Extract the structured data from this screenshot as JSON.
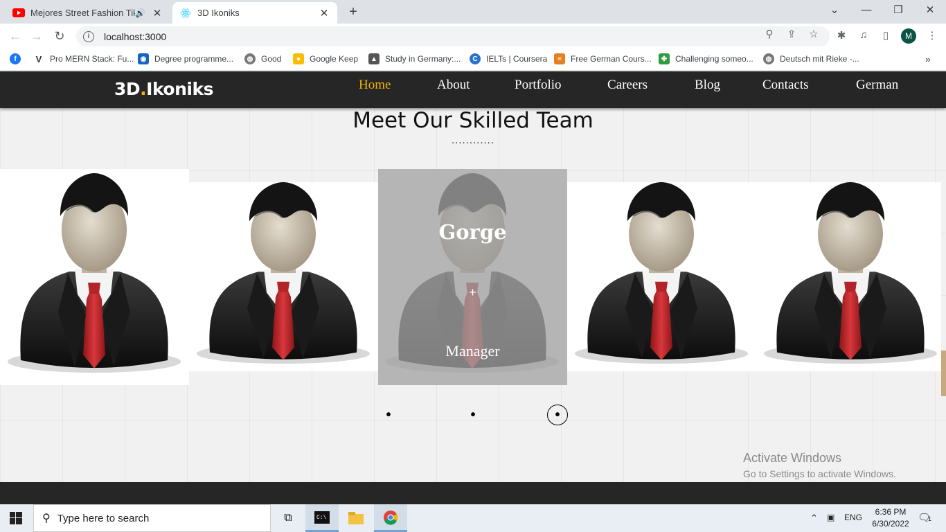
{
  "browser": {
    "tabs": [
      {
        "title": "Mejores Street Fashion Tik To",
        "active": false,
        "favicon": "youtube-icon",
        "audio": true
      },
      {
        "title": "3D Ikoniks",
        "active": true,
        "favicon": "react-icon"
      }
    ],
    "address": "localhost:3000",
    "profile_initial": "M",
    "bookmarks": [
      {
        "label": "Pro MERN Stack: Fu...",
        "icon": "v-icon"
      },
      {
        "label": "Degree programme...",
        "icon": "globe-blue-icon"
      },
      {
        "label": "Good",
        "icon": "globe-icon"
      },
      {
        "label": "Google Keep",
        "icon": "keep-icon"
      },
      {
        "label": "Study in Germany:...",
        "icon": "study-icon"
      },
      {
        "label": "IELTs | Coursera",
        "icon": "coursera-icon"
      },
      {
        "label": "Free German Cours...",
        "icon": "course-icon"
      },
      {
        "label": "Challenging someo...",
        "icon": "challenge-icon"
      },
      {
        "label": "Deutsch mit Rieke -...",
        "icon": "globe-icon"
      }
    ]
  },
  "site": {
    "logo_main": "3D",
    "logo_dot": ".",
    "logo_rest": "Ikoniks",
    "nav": [
      {
        "label": "Home",
        "active": true
      },
      {
        "label": "About"
      },
      {
        "label": "Portfolio"
      },
      {
        "label": "Careers"
      },
      {
        "label": "Blog"
      },
      {
        "label": "Contacts"
      },
      {
        "label": "German"
      }
    ],
    "heading": "Meet Our Skilled Team",
    "heading_dots": "............",
    "hover_card": {
      "name": "Gorge",
      "plus": "+",
      "role": "Manager"
    },
    "pager_dots": [
      "•",
      "•",
      "•"
    ],
    "watermark_title": "Activate Windows",
    "watermark_sub": "Go to Settings to activate Windows."
  },
  "taskbar": {
    "search_placeholder": "Type here to search",
    "lang": "ENG",
    "time": "6:36 PM",
    "date": "6/30/2022",
    "notif_count": "1"
  },
  "colors": {
    "accent": "#f0b400",
    "nav_bg": "#262626",
    "tie": "#c0262c"
  }
}
